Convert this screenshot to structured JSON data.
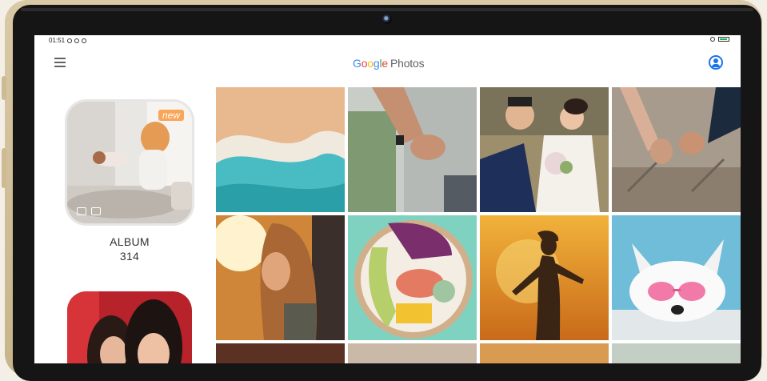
{
  "status": {
    "time": "01:51"
  },
  "header": {
    "logo_google": "Google",
    "logo_photos": "Photos"
  },
  "sidebar": {
    "album": {
      "badge": "new",
      "title": "ALBUM",
      "count": "314"
    }
  },
  "icons": {
    "menu": "hamburger-menu-icon",
    "account": "account-circle-icon",
    "camera": "camera-icon",
    "gallery": "image-icon"
  },
  "colors": {
    "google_blue": "#4285F4",
    "google_red": "#EA4335",
    "google_yellow": "#FBBC05",
    "google_green": "#34A853",
    "accent": "#1a73e8"
  },
  "photos": [
    {
      "id": "photo-ocean-waves"
    },
    {
      "id": "photo-holding-hands"
    },
    {
      "id": "photo-wedding-couple"
    },
    {
      "id": "photo-hands-track"
    },
    {
      "id": "photo-woman-sunlight"
    },
    {
      "id": "photo-poke-bowl"
    },
    {
      "id": "photo-runner-sunset"
    },
    {
      "id": "photo-dog-sunglasses"
    }
  ]
}
